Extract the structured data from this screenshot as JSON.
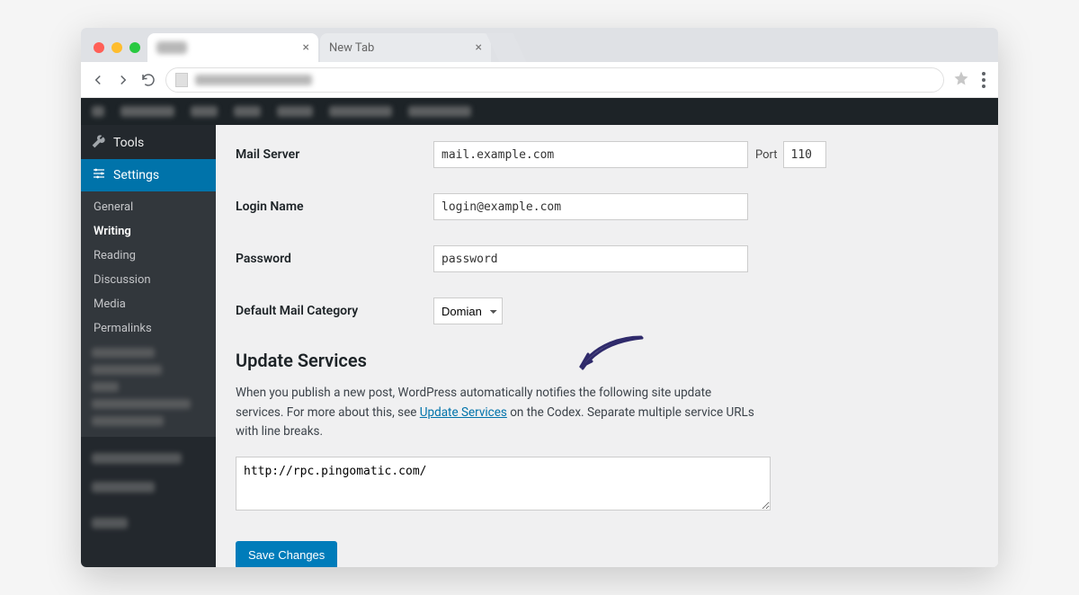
{
  "browser": {
    "tab_active_close": "×",
    "tab_new": "New Tab",
    "tab_new_close": "×"
  },
  "sidebar": {
    "tools": "Tools",
    "settings": "Settings",
    "sub": {
      "general": "General",
      "writing": "Writing",
      "reading": "Reading",
      "discussion": "Discussion",
      "media": "Media",
      "permalinks": "Permalinks"
    }
  },
  "form": {
    "mail_server_label": "Mail Server",
    "mail_server_value": "mail.example.com",
    "port_label": "Port",
    "port_value": "110",
    "login_label": "Login Name",
    "login_value": "login@example.com",
    "password_label": "Password",
    "password_value": "password",
    "default_cat_label": "Default Mail Category",
    "default_cat_value": "Domian"
  },
  "update": {
    "heading": "Update Services",
    "desc_pre": "When you publish a new post, WordPress automatically notifies the following site update services. For more about this, see ",
    "desc_link": "Update Services",
    "desc_post": " on the Codex. Separate multiple service URLs with line breaks.",
    "textarea_value": "http://rpc.pingomatic.com/"
  },
  "save_label": "Save Changes"
}
